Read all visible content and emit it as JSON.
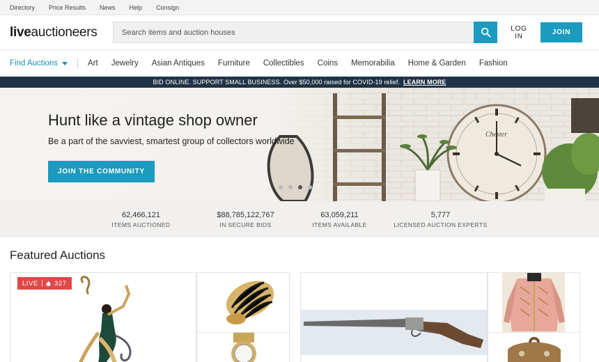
{
  "topbar": {
    "links": [
      "Directory",
      "Price Results",
      "News",
      "Help",
      "Consign"
    ]
  },
  "header": {
    "logo_light": "live",
    "logo_rest": "auctioneers",
    "search_placeholder": "Search items and auction houses",
    "login_label": "LOG IN",
    "join_label": "JOIN"
  },
  "nav": {
    "find_label": "Find Auctions",
    "items": [
      "Art",
      "Jewelry",
      "Asian Antiques",
      "Furniture",
      "Collectibles",
      "Coins",
      "Memorabilia",
      "Home & Garden",
      "Fashion"
    ]
  },
  "banner": {
    "text": "BID ONLINE. SUPPORT SMALL BUSINESS. Over $50,000 raised for COVID-19 relief.",
    "link": "LEARN MORE"
  },
  "hero": {
    "title": "Hunt like a vintage shop owner",
    "subtitle": "Be a part of the savviest, smartest group of collectors worldwide",
    "cta": "JOIN THE COMMUNITY",
    "clock_text": "Chester",
    "slides": 4,
    "active_slide": 2
  },
  "stats": [
    {
      "value": "62,466,121",
      "label": "ITEMS AUCTIONED"
    },
    {
      "value": "$88,785,122,767",
      "label": "IN SECURE BIDS"
    },
    {
      "value": "63,059,211",
      "label": "ITEMS AVAILABLE"
    },
    {
      "value": "5,777",
      "label": "LICENSED AUCTION EXPERTS"
    }
  ],
  "featured": {
    "title": "Featured Auctions",
    "live_label": "LIVE",
    "live_count": "327"
  },
  "colors": {
    "accent": "#1a9bbf",
    "banner_bg": "#203346",
    "live_red": "#e04848"
  }
}
